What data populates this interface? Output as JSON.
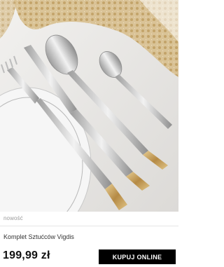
{
  "product": {
    "tag": "nowość",
    "name": "Komplet Sztućców Vigdis",
    "price": "199,99 zł",
    "buy_label": "KUPUJ ONLINE"
  },
  "colors": {
    "button_bg": "#000000",
    "button_text": "#ffffff",
    "gold": "#c9a96a"
  }
}
